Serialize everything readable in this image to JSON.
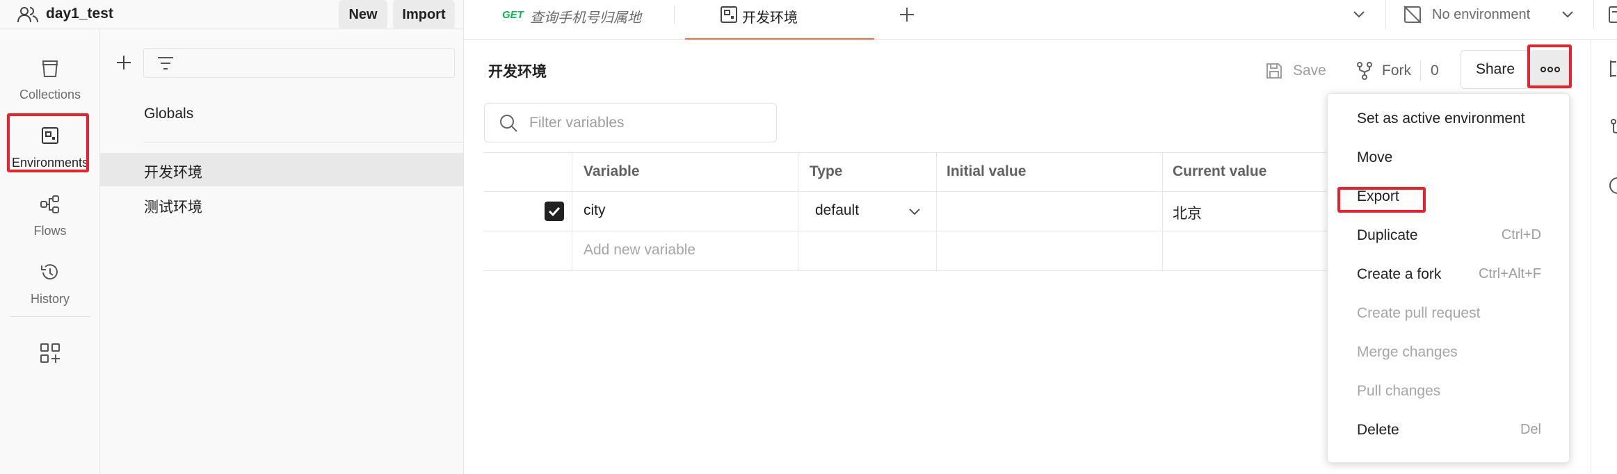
{
  "workspace": {
    "name": "day1_test",
    "new_label": "New",
    "import_label": "Import"
  },
  "rail": {
    "items": [
      {
        "label": "Collections",
        "icon": "collections-icon"
      },
      {
        "label": "Environments",
        "icon": "environments-icon"
      },
      {
        "label": "Flows",
        "icon": "flows-icon"
      },
      {
        "label": "History",
        "icon": "history-icon"
      }
    ]
  },
  "sidebar": {
    "globals": "Globals",
    "environments": [
      "开发环境",
      "测试环境"
    ]
  },
  "tabs": [
    {
      "method": "GET",
      "title": "查询手机号归属地"
    },
    {
      "title": "开发环境"
    }
  ],
  "env_select": {
    "value": "No environment"
  },
  "main": {
    "title": "开发环境",
    "save_label": "Save",
    "fork_label": "Fork",
    "fork_count": "0",
    "share_label": "Share",
    "filter_placeholder": "Filter variables"
  },
  "table": {
    "headers": [
      "Variable",
      "Type",
      "Initial value",
      "Current value"
    ],
    "rows": [
      {
        "variable": "city",
        "type": "default",
        "initial": "",
        "current": "北京",
        "checked": true
      }
    ],
    "add_placeholder": "Add new variable"
  },
  "menu": {
    "items": [
      {
        "label": "Set as active environment",
        "shortcut": "",
        "disabled": false
      },
      {
        "label": "Move",
        "shortcut": "",
        "disabled": false
      },
      {
        "label": "Export",
        "shortcut": "",
        "disabled": false
      },
      {
        "label": "Duplicate",
        "shortcut": "Ctrl+D",
        "disabled": false
      },
      {
        "label": "Create a fork",
        "shortcut": "Ctrl+Alt+F",
        "disabled": false
      },
      {
        "label": "Create pull request",
        "shortcut": "",
        "disabled": true
      },
      {
        "label": "Merge changes",
        "shortcut": "",
        "disabled": true
      },
      {
        "label": "Pull changes",
        "shortcut": "",
        "disabled": true
      },
      {
        "label": "Delete",
        "shortcut": "Del",
        "disabled": false
      }
    ]
  },
  "colors": {
    "accent": "#ff6c37",
    "highlight": "#e8232c",
    "get": "#0cbb52"
  }
}
